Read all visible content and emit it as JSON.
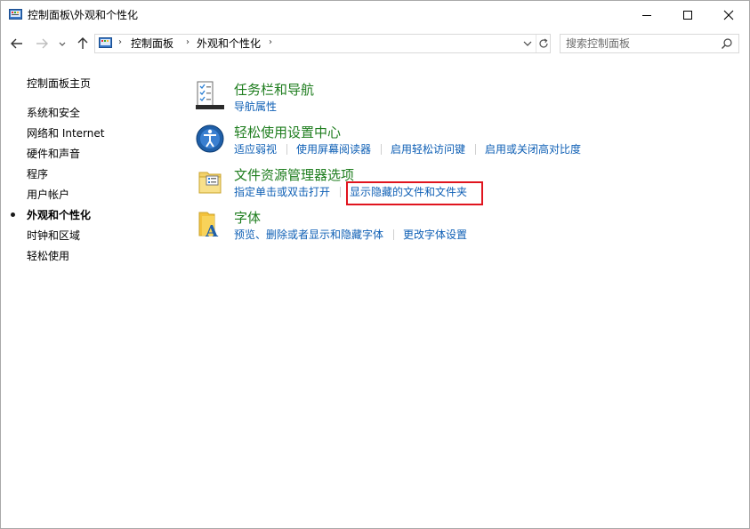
{
  "window": {
    "title": "控制面板\\外观和个性化"
  },
  "nav": {
    "breadcrumbs": [
      "控制面板",
      "外观和个性化"
    ],
    "search": {
      "placeholder": "搜索控制面板",
      "value": ""
    }
  },
  "sidebar": {
    "home": "控制面板主页",
    "items": [
      {
        "label": "系统和安全",
        "current": false
      },
      {
        "label": "网络和 Internet",
        "current": false
      },
      {
        "label": "硬件和声音",
        "current": false
      },
      {
        "label": "程序",
        "current": false
      },
      {
        "label": "用户帐户",
        "current": false
      },
      {
        "label": "外观和个性化",
        "current": true
      },
      {
        "label": "时钟和区域",
        "current": false
      },
      {
        "label": "轻松使用",
        "current": false
      }
    ]
  },
  "categories": [
    {
      "title": "任务栏和导航",
      "icon": "taskbar-icon",
      "links": [
        "导航属性"
      ]
    },
    {
      "title": "轻松使用设置中心",
      "icon": "ease-of-access-icon",
      "links": [
        "适应弱视",
        "使用屏幕阅读器",
        "启用轻松访问键",
        "启用或关闭高对比度"
      ]
    },
    {
      "title": "文件资源管理器选项",
      "icon": "folder-options-icon",
      "links": [
        "指定单击或双击打开",
        "显示隐藏的文件和文件夹"
      ]
    },
    {
      "title": "字体",
      "icon": "fonts-icon",
      "links": [
        "预览、删除或者显示和隐藏字体",
        "更改字体设置"
      ]
    }
  ],
  "colors": {
    "category_title": "#1e7d1e",
    "link": "#0e5fb5",
    "highlight_box": "#e0141e"
  }
}
